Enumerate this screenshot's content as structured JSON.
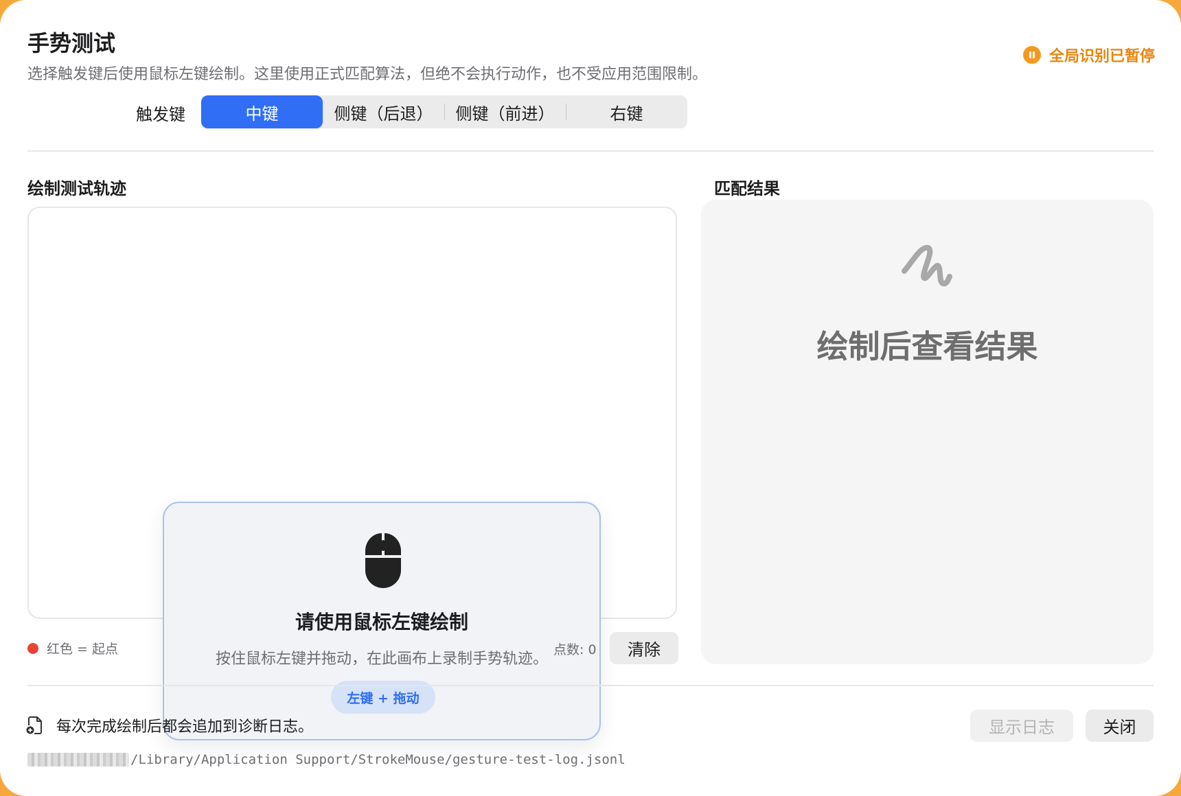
{
  "header": {
    "title": "手势测试",
    "subtitle": "选择触发键后使用鼠标左键绘制。这里使用正式匹配算法，但绝不会执行动作，也不受应用范围限制。",
    "status_text": "全局识别已暂停",
    "status_icon": "pause-circle-icon",
    "status_color": "#e8860f"
  },
  "trigger": {
    "label": "触发键",
    "options": [
      "中键",
      "侧键（后退）",
      "侧键（前进）",
      "右键"
    ],
    "selected": "中键",
    "accent": "#2f6ef5"
  },
  "draw_panel": {
    "title": "绘制测试轨迹",
    "prompt_icon": "mouse-icon",
    "prompt_title": "请使用鼠标左键绘制",
    "prompt_desc": "按住鼠标左键并拖动，在此画布上录制手势轨迹。",
    "prompt_pill": "左键 + 拖动",
    "legend_text": "红色 = 起点",
    "legend_color": "#ea4335",
    "count_text": "点数: 0",
    "clear_label": "清除"
  },
  "result_panel": {
    "title": "匹配结果",
    "icon": "scribble-icon",
    "placeholder": "绘制后查看结果"
  },
  "footer": {
    "icon": "document-add-icon",
    "note": "每次完成绘制后都会追加到诊断日志。",
    "log_path": "/Library/Application Support/StrokeMouse/gesture-test-log.jsonl",
    "show_log_label": "显示日志",
    "close_label": "关闭"
  }
}
